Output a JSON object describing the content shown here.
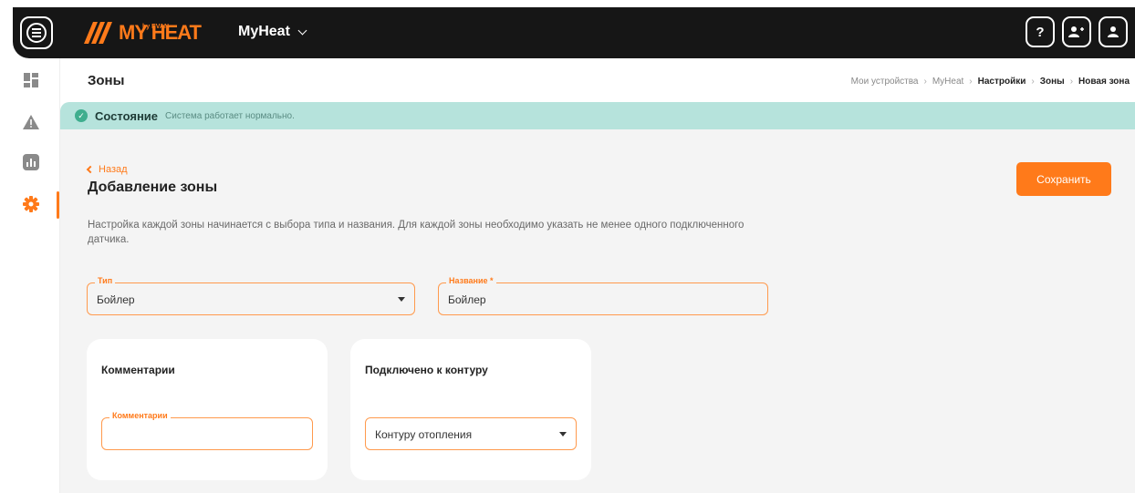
{
  "header": {
    "logo_text": "MY HEAT",
    "logo_small": "by EVAN",
    "device_name": "MyHeat",
    "icons": [
      "help-icon",
      "add-user-icon",
      "user-icon"
    ]
  },
  "sidebar": {
    "items": [
      {
        "icon": "dashboard-icon"
      },
      {
        "icon": "warning-icon"
      },
      {
        "icon": "chart-icon"
      },
      {
        "icon": "settings-icon",
        "active": true
      }
    ]
  },
  "page": {
    "title": "Зоны",
    "breadcrumb": [
      "Мои устройства",
      "MyHeat",
      "Настройки",
      "Зоны",
      "Новая зона"
    ]
  },
  "status": {
    "label": "Состояние",
    "text": "Система работает нормально."
  },
  "form": {
    "back_label": "Назад",
    "title": "Добавление зоны",
    "save_label": "Сохранить",
    "description": "Настройка каждой зоны начинается с выбора типа и названия. Для каждой зоны необходимо указать не менее одного подключенного датчика.",
    "type_field": {
      "label": "Тип",
      "value": "Бойлер"
    },
    "name_field": {
      "label": "Название *",
      "value": "Бойлер"
    },
    "comments_card": {
      "title": "Комментарии",
      "field_label": "Комментарии",
      "value": ""
    },
    "circuit_card": {
      "title": "Подключено к контуру",
      "value": "Контуру отопления"
    }
  },
  "colors": {
    "accent": "#ff7a1a",
    "status_bg": "#b6e3dc",
    "status_ok": "#3fae8e",
    "topbar": "#161616"
  }
}
